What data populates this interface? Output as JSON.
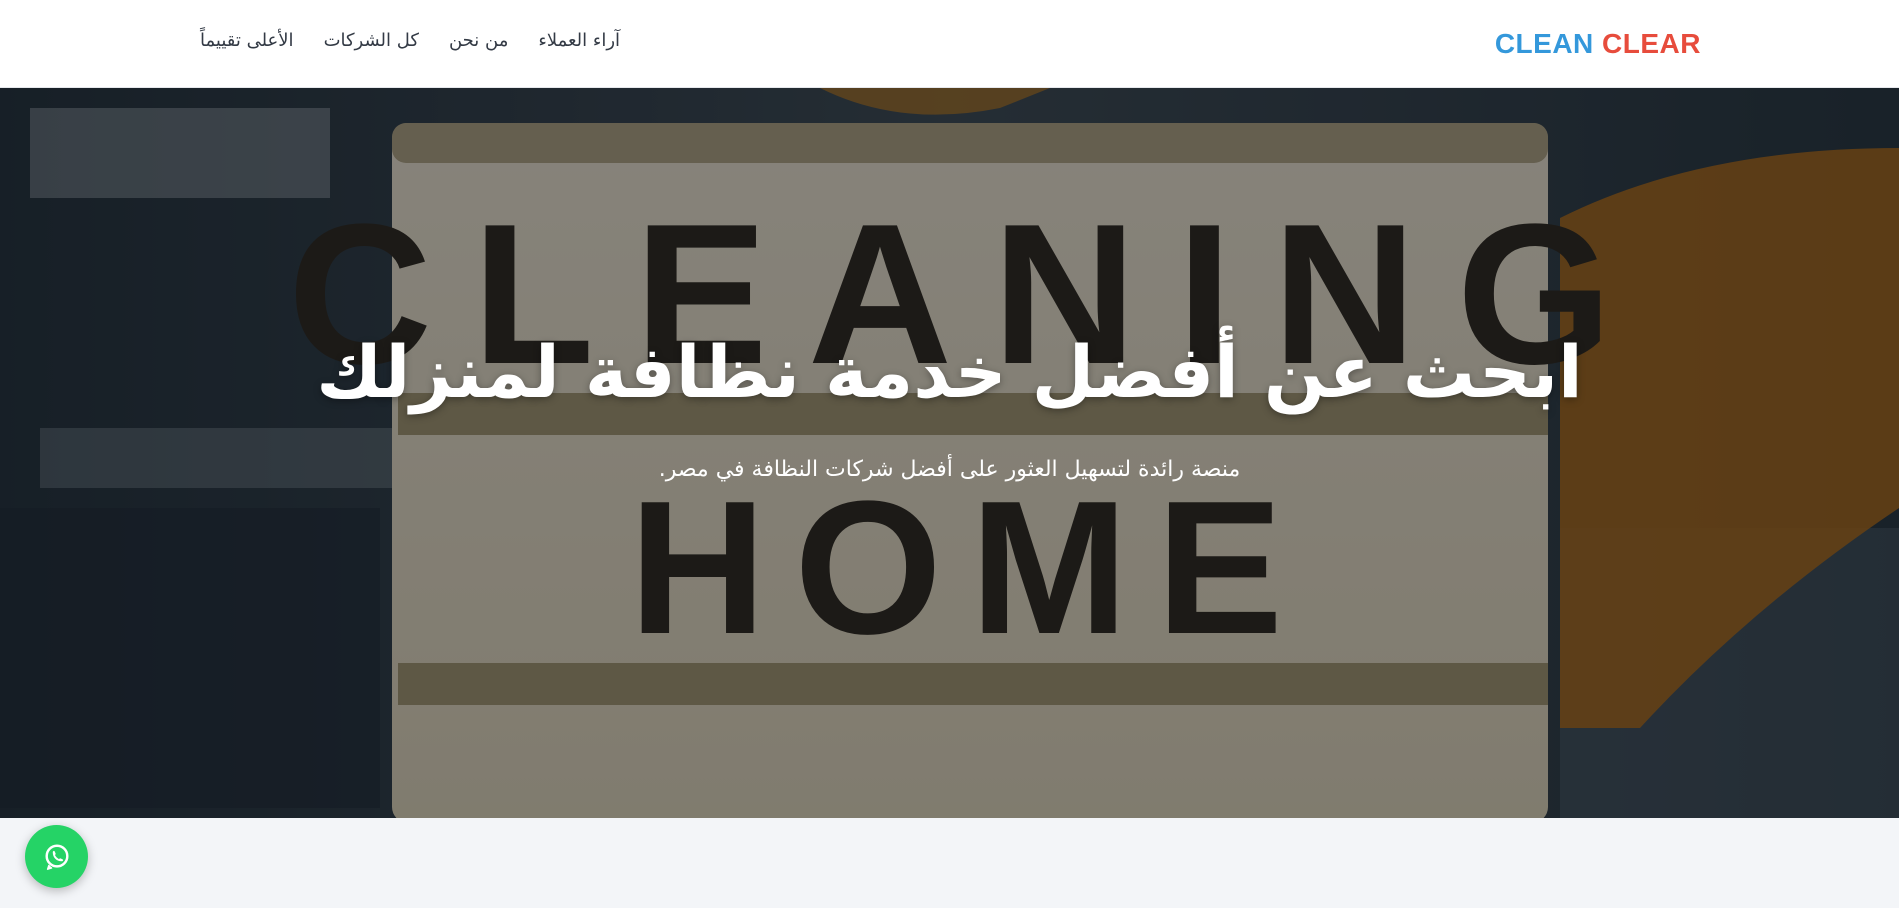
{
  "brand": {
    "word1": "CLEAN",
    "word2": "CLEAR",
    "color1": "#3498db",
    "color2": "#e74c3c"
  },
  "nav": {
    "items": [
      {
        "label": "الأعلى تقييماً"
      },
      {
        "label": "كل الشركات"
      },
      {
        "label": "من نحن"
      },
      {
        "label": "آراء العملاء"
      }
    ]
  },
  "hero": {
    "title": "ابحث عن أفضل خدمة نظافة لمنزلك",
    "subtitle": "منصة رائدة لتسهيل العثور على أفضل شركات النظافة في مصر.",
    "sign_line1": "CLEANING",
    "sign_line2": "HOME"
  },
  "floating": {
    "icon": "whatsapp-icon",
    "color": "#25d366"
  }
}
